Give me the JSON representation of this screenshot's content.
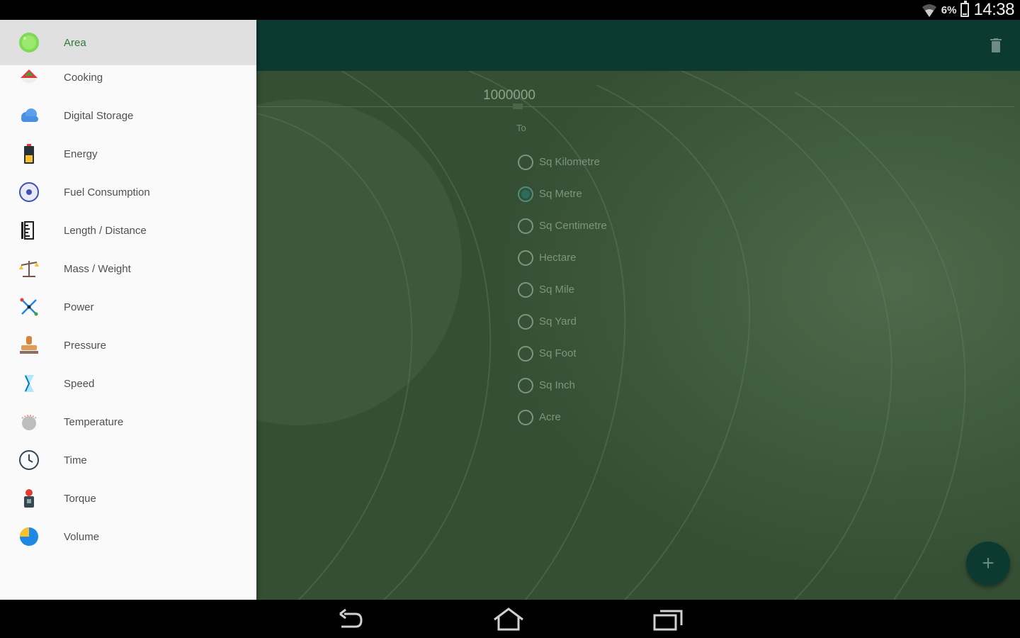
{
  "status_bar": {
    "battery_percent": "6%",
    "clock": "14:38"
  },
  "drawer": {
    "items": [
      {
        "label": "Area",
        "icon": "area-icon",
        "active": true
      },
      {
        "label": "Cooking",
        "icon": "cooking-icon"
      },
      {
        "label": "Digital Storage",
        "icon": "cloud-icon"
      },
      {
        "label": "Energy",
        "icon": "battery-icon"
      },
      {
        "label": "Fuel Consumption",
        "icon": "fuel-gauge-icon"
      },
      {
        "label": "Length / Distance",
        "icon": "ruler-icon"
      },
      {
        "label": "Mass / Weight",
        "icon": "scale-icon"
      },
      {
        "label": "Power",
        "icon": "power-icon"
      },
      {
        "label": "Pressure",
        "icon": "stamp-icon"
      },
      {
        "label": "Speed",
        "icon": "speed-icon"
      },
      {
        "label": "Temperature",
        "icon": "thermometer-icon"
      },
      {
        "label": "Time",
        "icon": "clock-icon"
      },
      {
        "label": "Torque",
        "icon": "torque-icon"
      },
      {
        "label": "Volume",
        "icon": "volume-pie-icon"
      }
    ]
  },
  "converter": {
    "input_value": "1000000",
    "to_label": "To",
    "units": [
      {
        "label": "Sq Kilometre",
        "checked": false
      },
      {
        "label": "Sq Metre",
        "checked": true
      },
      {
        "label": "Sq Centimetre",
        "checked": false
      },
      {
        "label": "Hectare",
        "checked": false
      },
      {
        "label": "Sq Mile",
        "checked": false
      },
      {
        "label": "Sq Yard",
        "checked": false
      },
      {
        "label": "Sq Foot",
        "checked": false
      },
      {
        "label": "Sq Inch",
        "checked": false
      },
      {
        "label": "Acre",
        "checked": false
      }
    ],
    "fab_symbol": "+"
  },
  "colors": {
    "app_bar": "#0d3a30",
    "accent": "#2a6d5c",
    "active_label": "#2e7d32"
  }
}
